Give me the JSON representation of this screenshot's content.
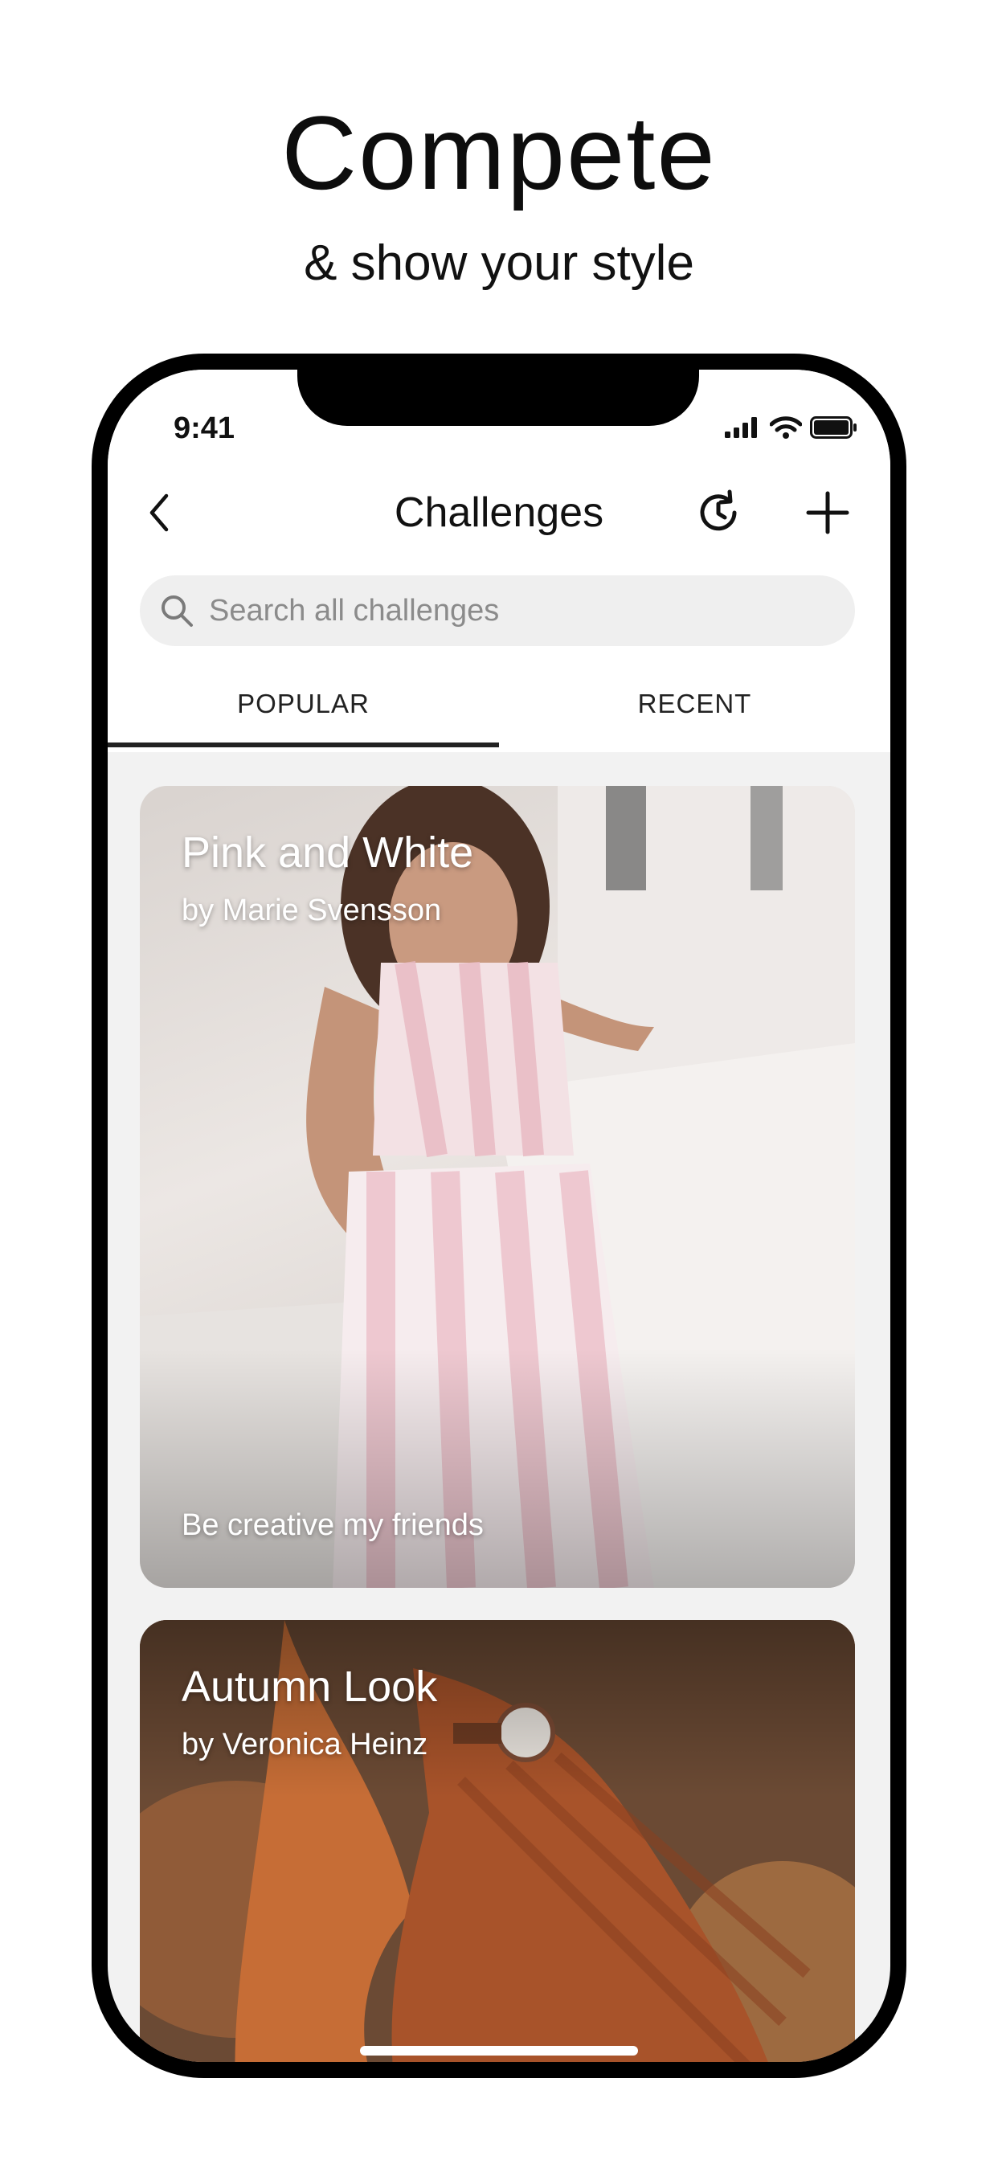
{
  "promo": {
    "headline": "Compete",
    "subheadline": "& show your style"
  },
  "status_bar": {
    "time": "9:41",
    "icons": [
      "signal-icon",
      "wifi-icon",
      "battery-icon"
    ]
  },
  "nav": {
    "title": "Challenges",
    "back_icon": "chevron-left-icon",
    "history_icon": "clock-refresh-icon",
    "add_icon": "plus-icon"
  },
  "search": {
    "placeholder": "Search all challenges",
    "value": ""
  },
  "tabs": [
    {
      "label": "POPULAR",
      "selected": true
    },
    {
      "label": "RECENT",
      "selected": false
    }
  ],
  "challenges": [
    {
      "title": "Pink and White",
      "author": "by Marie Svensson",
      "description": "Be creative my friends"
    },
    {
      "title": "Autumn Look",
      "author": "by Veronica Heinz",
      "description": ""
    }
  ],
  "colors": {
    "accent": "#222222",
    "search_bg": "#efefef",
    "screen_bg": "#f2f2f2"
  }
}
